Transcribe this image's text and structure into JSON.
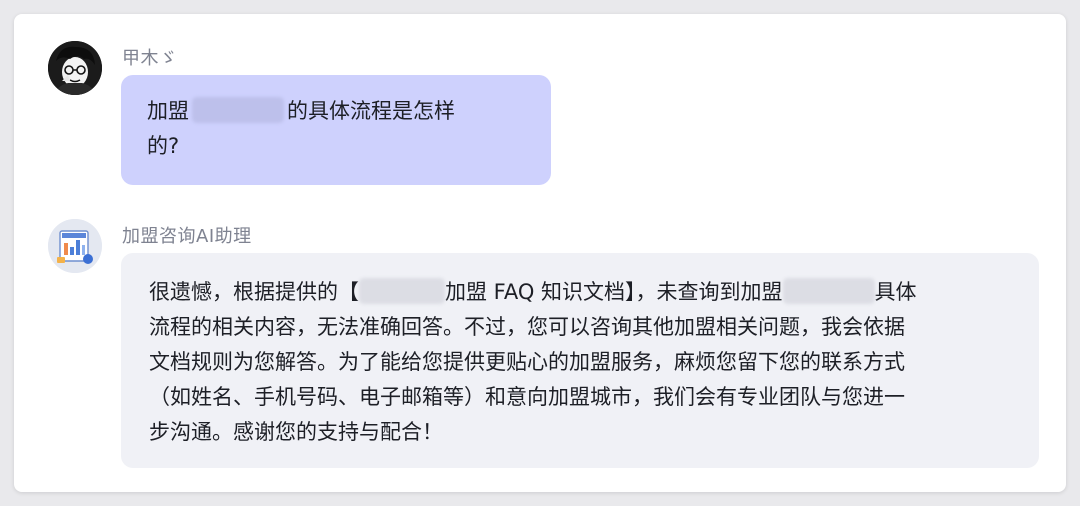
{
  "conversation": {
    "user": {
      "name": "甲木ゞ",
      "message_prefix": "加盟",
      "message_suffix_line1": "的具体流程是怎样",
      "message_line2": "的?"
    },
    "assistant": {
      "name": "加盟咨询AI助理",
      "line1_a": "很遗憾，根据提供的【",
      "line1_b": "加盟 FAQ 知识文档】，未查询到加盟",
      "line1_c": "具体",
      "line2": "流程的相关内容，无法准确回答。不过，您可以咨询其他加盟相关问题，我会依据",
      "line3": "文档规则为您解答。为了能给您提供更贴心的加盟服务，麻烦您留下您的联系方式",
      "line4": "（如姓名、手机号码、电子邮箱等）和意向加盟城市，我们会有专业团队与您进一",
      "line5": "步沟通。感谢您的支持与配合！"
    }
  },
  "icons": {
    "user_avatar": "user-avatar-icon",
    "assistant_avatar": "document-chart-icon"
  },
  "colors": {
    "user_bubble": "#ced1fd",
    "assistant_bubble": "#f0f1f6",
    "sender_name": "#7f8391",
    "text": "#1d1f26"
  }
}
